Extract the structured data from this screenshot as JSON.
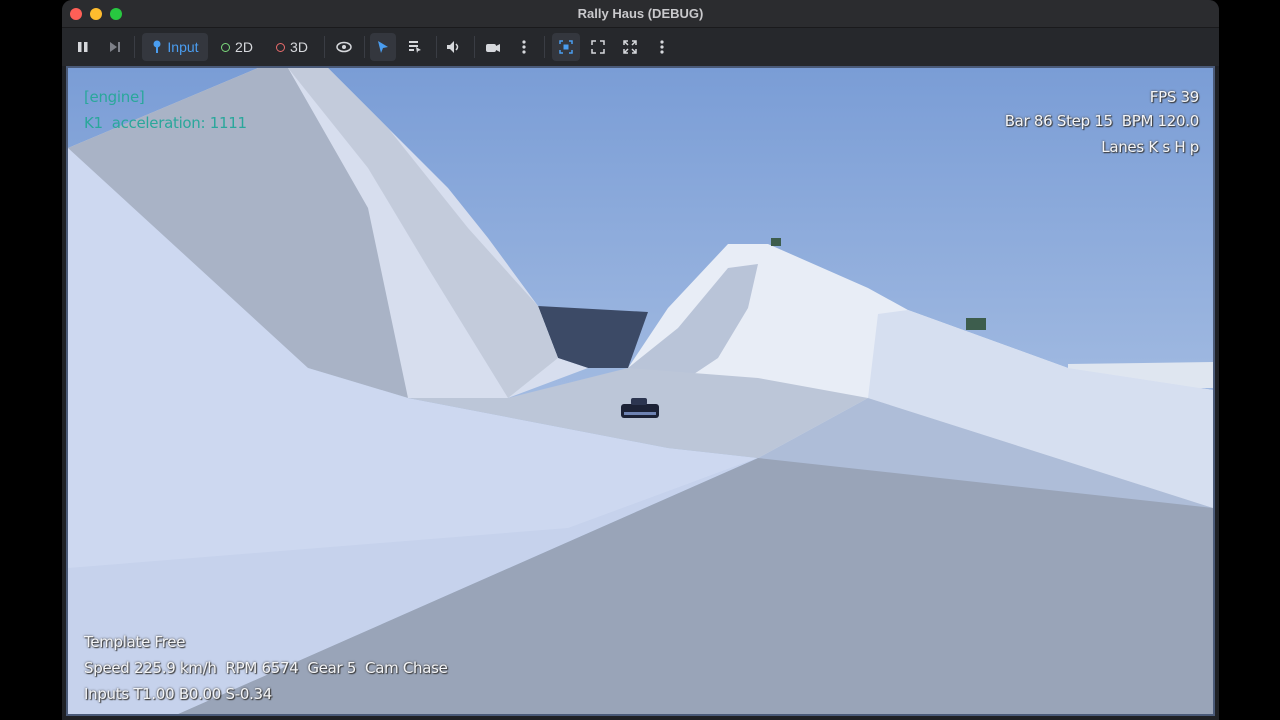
{
  "window": {
    "title": "Rally Haus (DEBUG)"
  },
  "toolbar": {
    "input_label": "Input",
    "mode_2d_label": "2D",
    "mode_3d_label": "3D",
    "colors": {
      "accent": "#4a9df0",
      "ring_2d": "#7bd87b",
      "ring_3d": "#e86b6b"
    }
  },
  "hud": {
    "debug_header": "[engine]",
    "debug_line": "K1  acceleration: 1111",
    "fps": "FPS 39",
    "bar_line": "Bar 86 Step 15  BPM 120.0",
    "lanes": "Lanes K s H p",
    "template": "Template Free",
    "speed_line": "Speed 225.9 km/h  RPM 6574  Gear 5  Cam Chase",
    "inputs_line": "Inputs T1.00 B0.00 S-0.34"
  }
}
